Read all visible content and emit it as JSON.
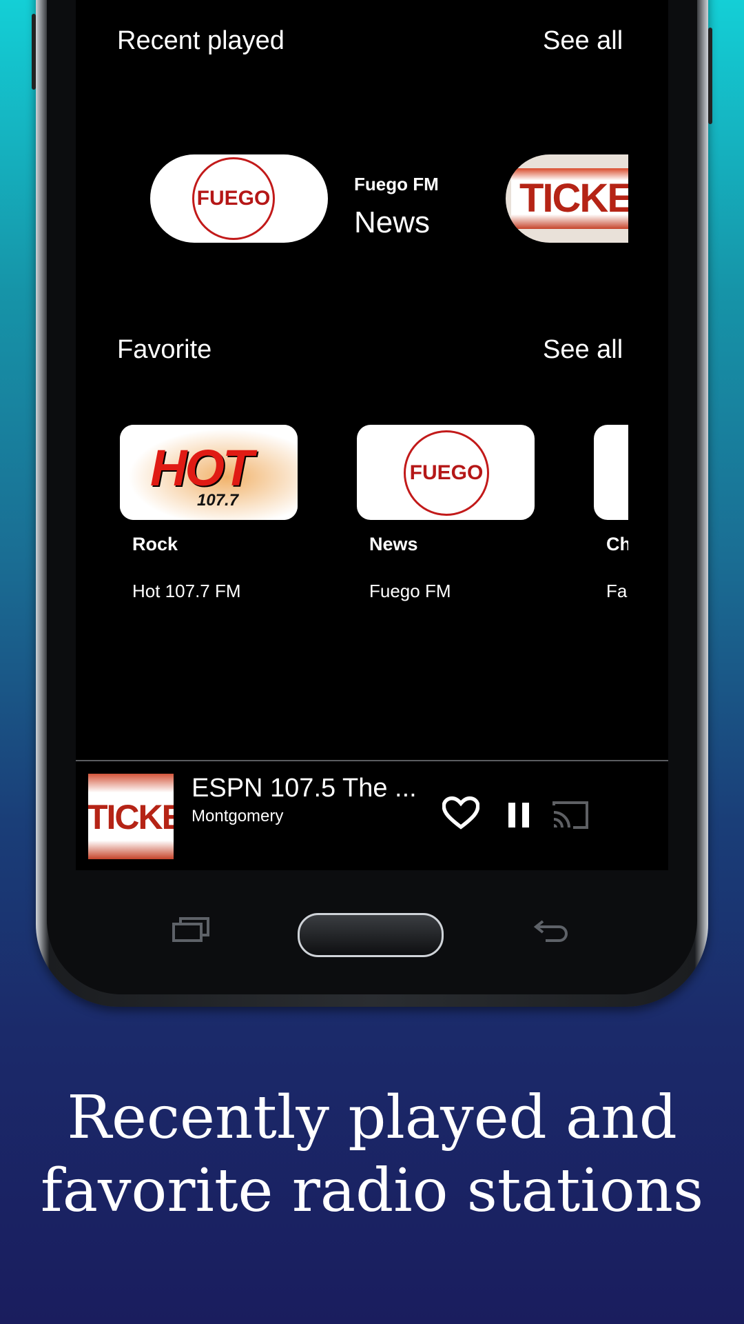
{
  "recent": {
    "title": "Recent played",
    "see_all": "See all",
    "items": [
      {
        "logo_text": "FUEGO",
        "name": "Fuego FM",
        "genre": "News"
      },
      {
        "logo_text": "TICKE",
        "name": "",
        "genre": ""
      }
    ]
  },
  "favorite": {
    "title": "Favorite",
    "see_all": "See all",
    "items": [
      {
        "logo_text": "HOT",
        "logo_sub": "107.7",
        "genre": "Rock",
        "name": "Hot 107.7 FM"
      },
      {
        "logo_text": "FUEGO",
        "genre": "News",
        "name": "Fuego FM"
      },
      {
        "logo_text": "",
        "genre": "Ch",
        "name": "Fa"
      }
    ]
  },
  "player": {
    "logo_text": "TICKE",
    "title": "ESPN 107.5 The ...",
    "subtitle": "Montgomery",
    "icons": [
      "heart-icon",
      "pause-icon",
      "cast-icon"
    ]
  },
  "caption": {
    "line1": "Recently played and",
    "line2": "favorite radio stations"
  },
  "colors": {
    "background_top": "#14cfd6",
    "background_bottom": "#1a1d5e",
    "screen": "#000000",
    "logo_red": "#c21a1a"
  }
}
